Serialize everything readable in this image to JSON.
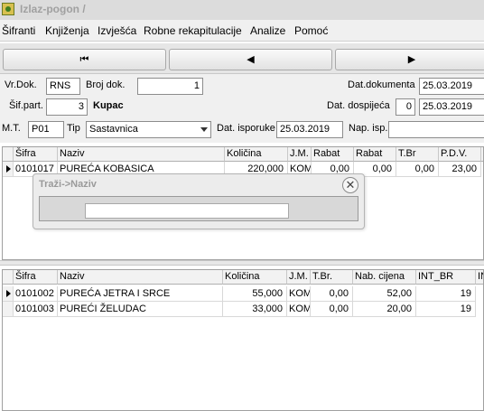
{
  "window": {
    "title": "Izlaz-pogon /"
  },
  "menu": [
    "Šifranti",
    "Knjiženja",
    "Izvješća",
    "Robne rekapitulacije",
    "Analize",
    "Pomoć"
  ],
  "nav": {
    "first": "⏮",
    "prev": "◀",
    "next": "▶"
  },
  "form": {
    "vrdok_label": "Vr.Dok.",
    "vrdok_value": "RNS",
    "brojdok_label": "Broj dok.",
    "brojdok_value": "1",
    "datdok_label": "Dat.dokumenta",
    "datdok_value": "25.03.2019",
    "sifpart_label": "Šif.part.",
    "sifpart_value": "3",
    "kupac": "Kupac",
    "datdosp_label": "Dat. dospijeća",
    "datdosp_days": "0",
    "datdosp_value": "25.03.2019",
    "mt_label": "M.T.",
    "mt_value": "P01",
    "tip_label": "Tip",
    "tip_value": "Sastavnica",
    "datisp_label": "Dat. isporuke",
    "datisp_value": "25.03.2019",
    "napisp_label": "Nap. isp.",
    "napisp_value": ""
  },
  "grid1": {
    "headers": [
      "Šifra",
      "Naziv",
      "Količina",
      "J.M.",
      "Rabat",
      "Rabat",
      "T.Br",
      "P.D.V.",
      "("
    ],
    "rows": [
      [
        "0101017",
        "PUREĆA KOBASICA",
        "220,000",
        "KOM",
        "0,00",
        "0,00",
        "0,00",
        "23,00",
        ""
      ]
    ]
  },
  "grid2": {
    "headers": [
      "Šifra",
      "Naziv",
      "Količina",
      "J.M.",
      "T.Br.",
      "Nab. cijena",
      "INT_BR",
      "IN"
    ],
    "rows": [
      [
        "0101002",
        "PUREĆA JETRA I SRCE",
        "55,000",
        "KOM",
        "0,00",
        "52,00",
        "19",
        ""
      ],
      [
        "0101003",
        "PUREĆI ŽELUDAC",
        "33,000",
        "KOM",
        "0,00",
        "20,00",
        "19",
        ""
      ]
    ]
  },
  "popup": {
    "title": "Traži->Naziv",
    "close": "✕",
    "input_value": ""
  }
}
